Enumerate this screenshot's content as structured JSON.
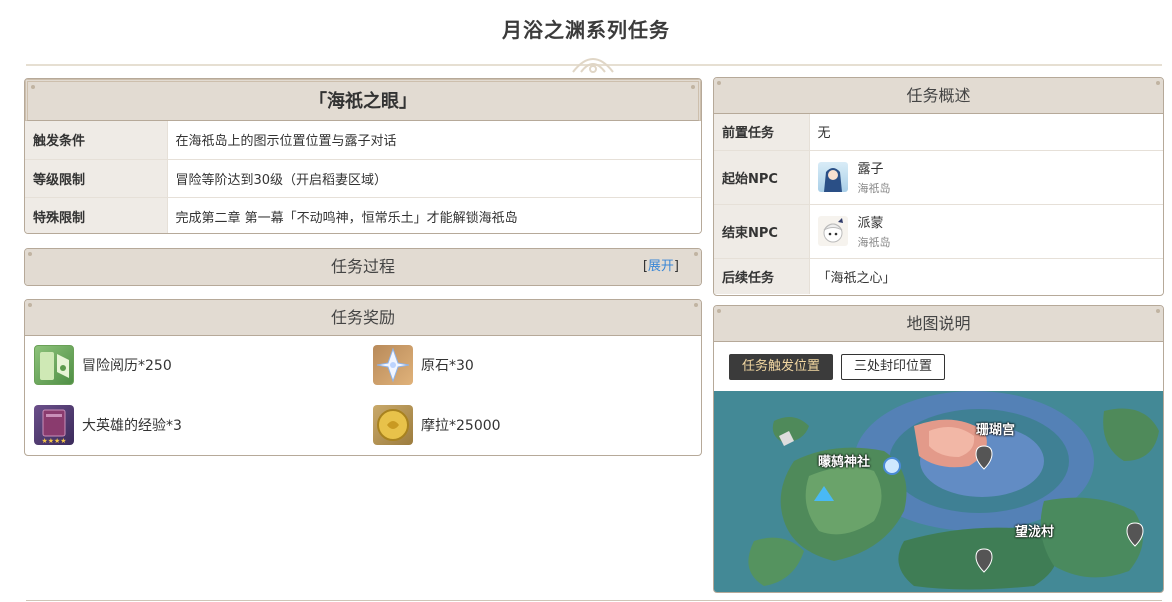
{
  "page": {
    "title": "月浴之渊系列任务"
  },
  "quest": {
    "title": "「海祇之眼」",
    "rows": [
      {
        "label": "触发条件",
        "value": "在海祇岛上的图示位置位置与露子对话"
      },
      {
        "label": "等级限制",
        "value": "冒险等阶达到30级（开启稻妻区域）"
      },
      {
        "label": "特殊限制",
        "value": "完成第二章 第一幕「不动鸣神，恒常乐土」才能解锁海祇岛"
      }
    ]
  },
  "process": {
    "title": "任务过程",
    "expand_open": "[",
    "expand_label": "展开",
    "expand_close": "]"
  },
  "rewards": {
    "title": "任务奖励",
    "items": [
      {
        "label": "冒险阅历*250",
        "icon": "adventure-exp-icon"
      },
      {
        "label": "原石*30",
        "icon": "primogem-icon"
      },
      {
        "label": "大英雄的经验*3",
        "icon": "heros-wit-icon"
      },
      {
        "label": "摩拉*25000",
        "icon": "mora-icon"
      }
    ]
  },
  "overview": {
    "title": "任务概述",
    "prereq_label": "前置任务",
    "prereq_value": "无",
    "start_label": "起始NPC",
    "start_npc": {
      "name": "露子",
      "location": "海祇岛"
    },
    "end_label": "结束NPC",
    "end_npc": {
      "name": "派蒙",
      "location": "海祇岛"
    },
    "next_label": "后续任务",
    "next_value": "「海祇之心」"
  },
  "map": {
    "title": "地图说明",
    "tabs": [
      "任务触发位置",
      "三处封印位置"
    ],
    "active_tab": 0,
    "labels": {
      "shrine": "曚鸫神社",
      "palace": "珊瑚宫",
      "village": "望泷村"
    }
  },
  "colors": {
    "header_bg": "#e2dbd2",
    "border": "#b6a999",
    "link": "#3a87d6",
    "active_tab_bg": "#3b3b3b",
    "active_tab_text": "#f3d8a2"
  }
}
